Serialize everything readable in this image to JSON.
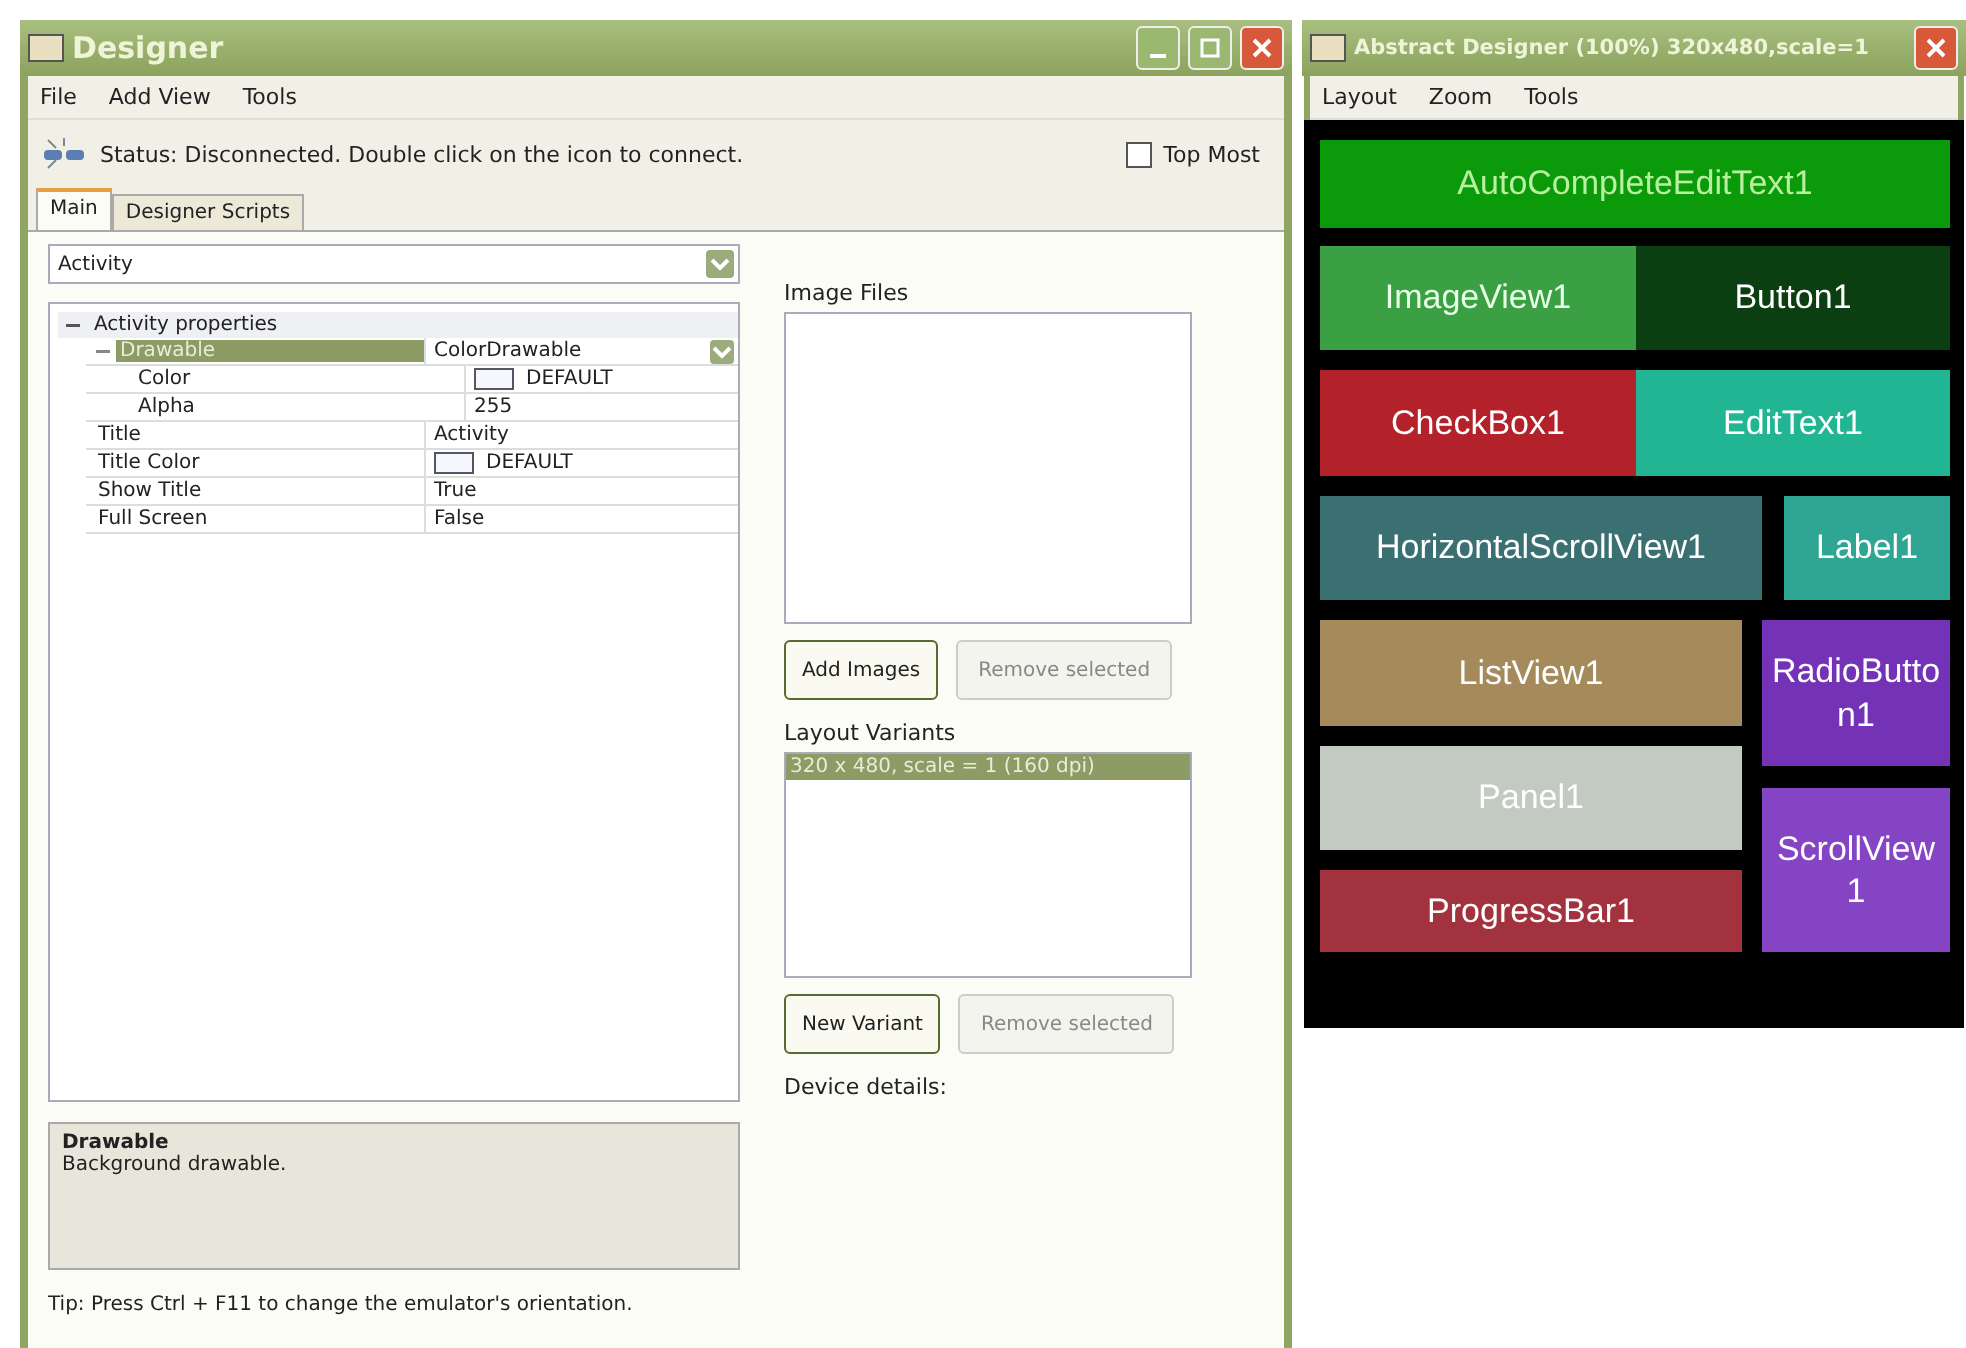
{
  "designer": {
    "title": "Designer",
    "menu": [
      {
        "label": "File"
      },
      {
        "label": "Add View"
      },
      {
        "label": "Tools"
      }
    ],
    "status": "Status: Disconnected. Double click on the icon to connect.",
    "top_most": {
      "label": "Top Most",
      "checked": false
    },
    "tabs": [
      {
        "label": "Main",
        "selected": true
      },
      {
        "label": "Designer Scripts",
        "selected": false
      }
    ],
    "object_select": "Activity",
    "properties": {
      "category": "Activity properties",
      "expanded": true,
      "rows": [
        {
          "name": "Drawable",
          "value": "ColorDrawable",
          "kind": "dropdown",
          "selected": true,
          "expanded": true,
          "children": [
            {
              "name": "Color",
              "value": "DEFAULT",
              "kind": "color",
              "selected": false
            },
            {
              "name": "Alpha",
              "value": "255",
              "kind": "text",
              "selected": false
            }
          ]
        },
        {
          "name": "Title",
          "value": "Activity",
          "kind": "text",
          "selected": false
        },
        {
          "name": "Title Color",
          "value": "DEFAULT",
          "kind": "color",
          "selected": false
        },
        {
          "name": "Show Title",
          "value": "True",
          "kind": "text",
          "selected": false
        },
        {
          "name": "Full Screen",
          "value": "False",
          "kind": "text",
          "selected": false
        }
      ]
    },
    "description": {
      "title": "Drawable",
      "text": "Background drawable."
    },
    "tip": "Tip: Press Ctrl + F11 to change the emulator's orientation.",
    "image_files": {
      "label": "Image Files",
      "add": "Add Images",
      "remove": "Remove selected",
      "remove_disabled": true
    },
    "layout_variants": {
      "label": "Layout Variants",
      "items": [
        {
          "label": "320 x 480, scale = 1 (160 dpi)",
          "selected": true
        }
      ],
      "add": "New Variant",
      "remove": "Remove selected",
      "remove_disabled": true
    },
    "device_details": "Device details:"
  },
  "abstract_designer": {
    "title": "Abstract Designer (100%) 320x480,scale=1",
    "menu": [
      {
        "label": "Layout"
      },
      {
        "label": "Zoom"
      },
      {
        "label": "Tools"
      }
    ],
    "views": [
      {
        "label": "AutoCompleteEditText1",
        "color": "#0a9a0a"
      },
      {
        "label": "ImageView1",
        "color": "#3aa043"
      },
      {
        "label": "Button1",
        "color": "#0b3f12"
      },
      {
        "label": "CheckBox1",
        "color": "#b3222a"
      },
      {
        "label": "EditText1",
        "color": "#22b594"
      },
      {
        "label": "HorizontalScrollView1",
        "color": "#3a7072"
      },
      {
        "label": "Label1",
        "color": "#2fa593"
      },
      {
        "label": "ListView1",
        "color": "#a58b5c"
      },
      {
        "label": "RadioButton1",
        "color": "#7433b6"
      },
      {
        "label": "Panel1",
        "color": "#c2cac2"
      },
      {
        "label": "ScrollView1",
        "color": "#8544c4"
      },
      {
        "label": "ProgressBar1",
        "color": "#a3323f"
      }
    ]
  }
}
